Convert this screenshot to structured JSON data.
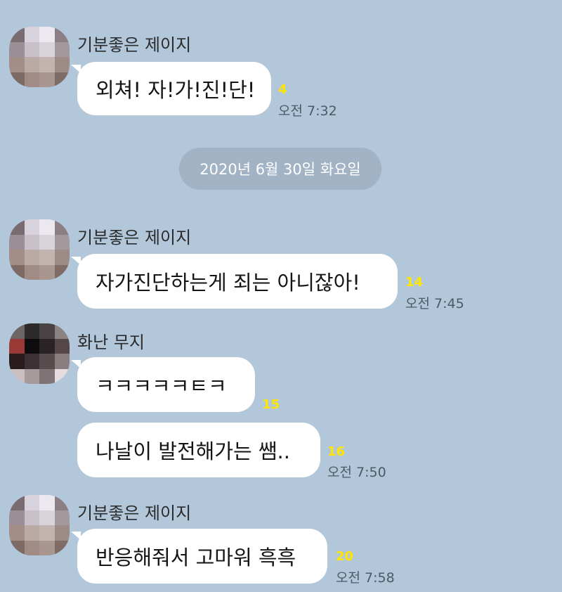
{
  "users": {
    "jay": {
      "name": "기분좋은 제이지",
      "avatar_colors": [
        "#7a6d71",
        "#d8d2dd",
        "#ece8f0",
        "#8b7f85",
        "#9a8f95",
        "#c9c1c9",
        "#d9d3da",
        "#a4989c",
        "#a38e88",
        "#b9aaa6",
        "#c3b4b0",
        "#9d8b86",
        "#7d6a64",
        "#a08c84",
        "#a99690",
        "#806c66"
      ]
    },
    "muji": {
      "name": "화난 무지",
      "avatar_colors": [
        "#6d6466",
        "#2d2a2c",
        "#4a4245",
        "#8b8284",
        "#9a3a36",
        "#0e0c0e",
        "#2a2326",
        "#55464a",
        "#2a1c1e",
        "#3b3034",
        "#574b4e",
        "#8a7d80",
        "#c9bfc1",
        "#a49a9c",
        "#7e7476",
        "#e4dcde"
      ]
    }
  },
  "messages": {
    "m1": {
      "text": "외쳐! 자!가!진!단!",
      "count": "4",
      "time": "오전 7:32"
    },
    "date_divider": "2020년 6월 30일 화요일",
    "m2": {
      "text": "자가진단하는게 죄는 아니잖아!",
      "count": "14",
      "time": "오전 7:45"
    },
    "m3": {
      "text": "ㅋㅋㅋㅋㅋㅌㅋ",
      "count": "15"
    },
    "m4": {
      "text": "나날이 발전해가는 쌤..",
      "count": "16",
      "time": "오전 7:50"
    },
    "m5": {
      "text": "반응해줘서 고마워 흑흑",
      "count": "20",
      "time": "오전 7:58"
    }
  }
}
